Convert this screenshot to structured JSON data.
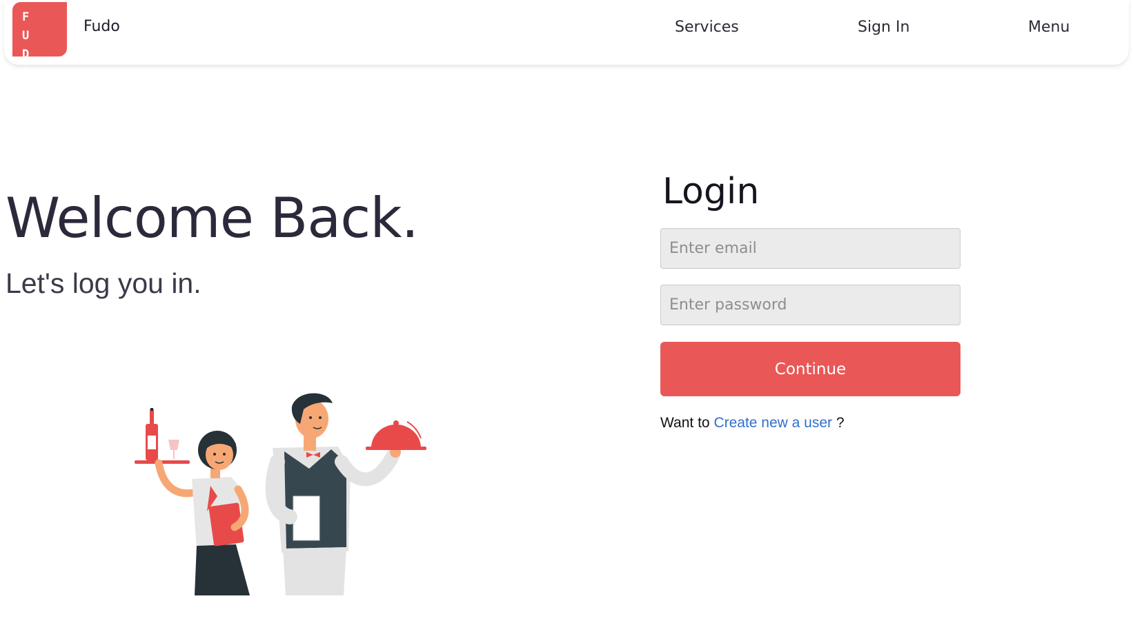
{
  "header": {
    "logo_letters": [
      "F U",
      "D O"
    ],
    "brand": "Fudo",
    "nav": [
      "Services",
      "Sign In",
      "Menu"
    ]
  },
  "hero": {
    "title": "Welcome Back.",
    "subtitle": "Let's log you in."
  },
  "login": {
    "title": "Login",
    "email_placeholder": "Enter email",
    "password_placeholder": "Enter password",
    "continue_label": "Continue",
    "signup_prefix": "Want to",
    "signup_link": "Create new a user",
    "signup_suffix": "?"
  },
  "colors": {
    "accent": "#ea5757",
    "link": "#2f6fce",
    "heading": "#2b2a3b"
  },
  "illustration": {
    "icon": "waiters-illustration"
  }
}
